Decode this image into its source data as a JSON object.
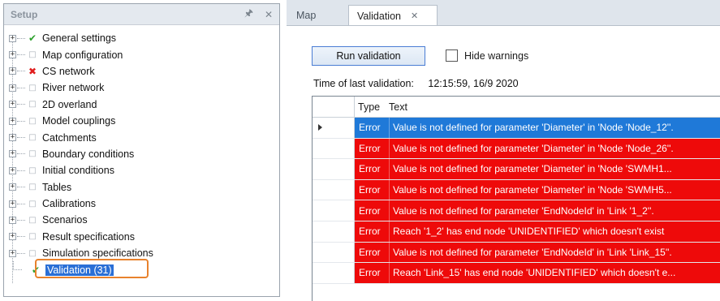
{
  "setup": {
    "title": "Setup",
    "pin_icon": "pin-icon",
    "close_icon": "close-icon",
    "items": [
      {
        "label": "General settings",
        "status": "ok"
      },
      {
        "label": "Map configuration",
        "status": "none"
      },
      {
        "label": "CS network",
        "status": "error"
      },
      {
        "label": "River network",
        "status": "none"
      },
      {
        "label": "2D overland",
        "status": "none"
      },
      {
        "label": "Model couplings",
        "status": "none"
      },
      {
        "label": "Catchments",
        "status": "none"
      },
      {
        "label": "Boundary conditions",
        "status": "none"
      },
      {
        "label": "Initial conditions",
        "status": "none"
      },
      {
        "label": "Tables",
        "status": "none"
      },
      {
        "label": "Calibrations",
        "status": "none"
      },
      {
        "label": "Scenarios",
        "status": "none"
      },
      {
        "label": "Result specifications",
        "status": "none"
      },
      {
        "label": "Simulation specifications",
        "status": "none"
      }
    ],
    "validation": {
      "label": "Validation (31)",
      "status": "ok"
    },
    "highlight_color": "#e8822d"
  },
  "tabs": {
    "map": "Map",
    "validation": "Validation",
    "close_glyph": "✕"
  },
  "validation": {
    "run_button": "Run validation",
    "hide_warnings": "Hide warnings",
    "hide_warnings_checked": false,
    "time_label": "Time of last validation:",
    "time_value": "12:15:59, 16/9 2020",
    "columns": {
      "type": "Type",
      "text": "Text"
    },
    "rows": [
      {
        "type": "Error",
        "text": "Value is not defined for parameter 'Diameter' in 'Node 'Node_12''.",
        "selected": true
      },
      {
        "type": "Error",
        "text": "Value is not defined for parameter 'Diameter' in 'Node 'Node_26''.",
        "selected": false
      },
      {
        "type": "Error",
        "text": "Value is not defined for parameter 'Diameter' in 'Node 'SWMH1...",
        "selected": false
      },
      {
        "type": "Error",
        "text": "Value is not defined for parameter 'Diameter' in 'Node 'SWMH5...",
        "selected": false
      },
      {
        "type": "Error",
        "text": "Value is not defined for parameter 'EndNodeId' in 'Link '1_2''.",
        "selected": false
      },
      {
        "type": "Error",
        "text": "Reach '1_2' has end node 'UNIDENTIFIED' which doesn't exist",
        "selected": false
      },
      {
        "type": "Error",
        "text": "Value is not defined for parameter 'EndNodeId' in 'Link 'Link_15''.",
        "selected": false
      },
      {
        "type": "Error",
        "text": "Reach 'Link_15' has end node 'UNIDENTIFIED' which doesn't e...",
        "selected": false
      }
    ],
    "error_color": "#ee0a0a",
    "selected_color": "#1f79d8"
  }
}
